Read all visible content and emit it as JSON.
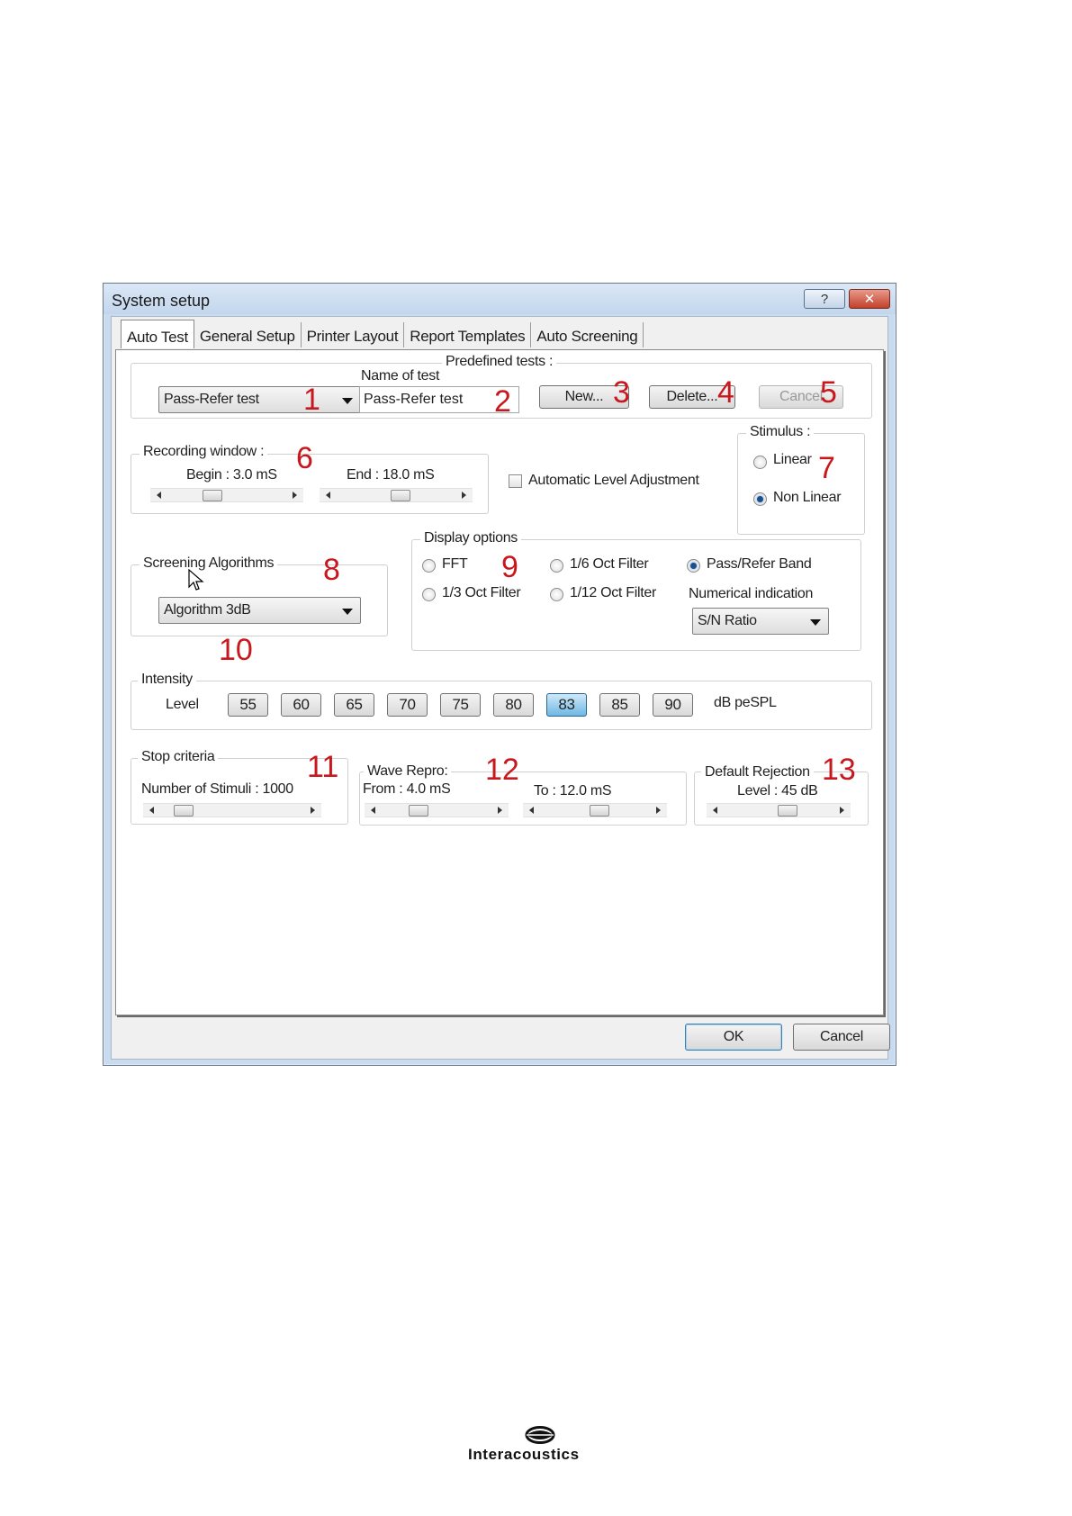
{
  "window": {
    "title": "System setup",
    "help_label": "?",
    "close_label": "✕"
  },
  "tabs": [
    "Auto Test",
    "General Setup",
    "Printer Layout",
    "Report Templates",
    "Auto Screening"
  ],
  "predefined": {
    "group_label": "Predefined tests :",
    "combo_value": "Pass-Refer test",
    "name_label": "Name of test",
    "name_value": "Pass-Refer test",
    "new_label": "New...",
    "delete_label": "Delete...",
    "cancel_label": "Cancel"
  },
  "recording": {
    "group_label": "Recording window  :",
    "begin_label": "Begin : 3.0 mS",
    "end_label": "End : 18.0 mS",
    "begin_level": 0.35,
    "end_level": 0.55
  },
  "auto_level": {
    "label": "Automatic Level Adjustment",
    "checked": false
  },
  "stimulus": {
    "group_label": "Stimulus :",
    "options": [
      "Linear",
      "Non Linear"
    ],
    "selected": "Non Linear"
  },
  "screening": {
    "group_label": "Screening Algorithms",
    "value": "Algorithm 3dB"
  },
  "display": {
    "group_label": "Display options",
    "options": [
      "FFT",
      "1/3 Oct Filter",
      "1/6 Oct Filter",
      "1/12 Oct Filter",
      "Pass/Refer Band"
    ],
    "selected": "Pass/Refer Band",
    "numerical_label": "Numerical indication",
    "numerical_value": "S/N Ratio"
  },
  "intensity": {
    "group_label": "Intensity",
    "level_label": "Level",
    "levels": [
      "55",
      "60",
      "65",
      "70",
      "75",
      "80",
      "83",
      "85",
      "90"
    ],
    "selected": "83",
    "unit": "dB peSPL"
  },
  "stop": {
    "group_label": "Stop criteria",
    "stimuli_label": "Number of Stimuli : 1000",
    "level": 0.1
  },
  "wave_repro": {
    "label": "Wave Repro:",
    "from_label": "From : 4.0 mS",
    "to_label": "To : 12.0 mS",
    "from_level": 0.3,
    "to_level": 0.55
  },
  "rejection": {
    "label1": "Default Rejection",
    "label2": "Level : 45 dB",
    "level": 0.6
  },
  "buttons": {
    "ok": "OK",
    "cancel": "Cancel"
  },
  "callouts": [
    "1",
    "2",
    "3",
    "4",
    "5",
    "6",
    "7",
    "8",
    "9",
    "10",
    "11",
    "12",
    "13"
  ],
  "footer": {
    "brand": "Interacoustics"
  },
  "colors": {
    "callout": "#c8181e",
    "title_bar": "#c9dcef",
    "selected_level": "#6fb7e3"
  }
}
